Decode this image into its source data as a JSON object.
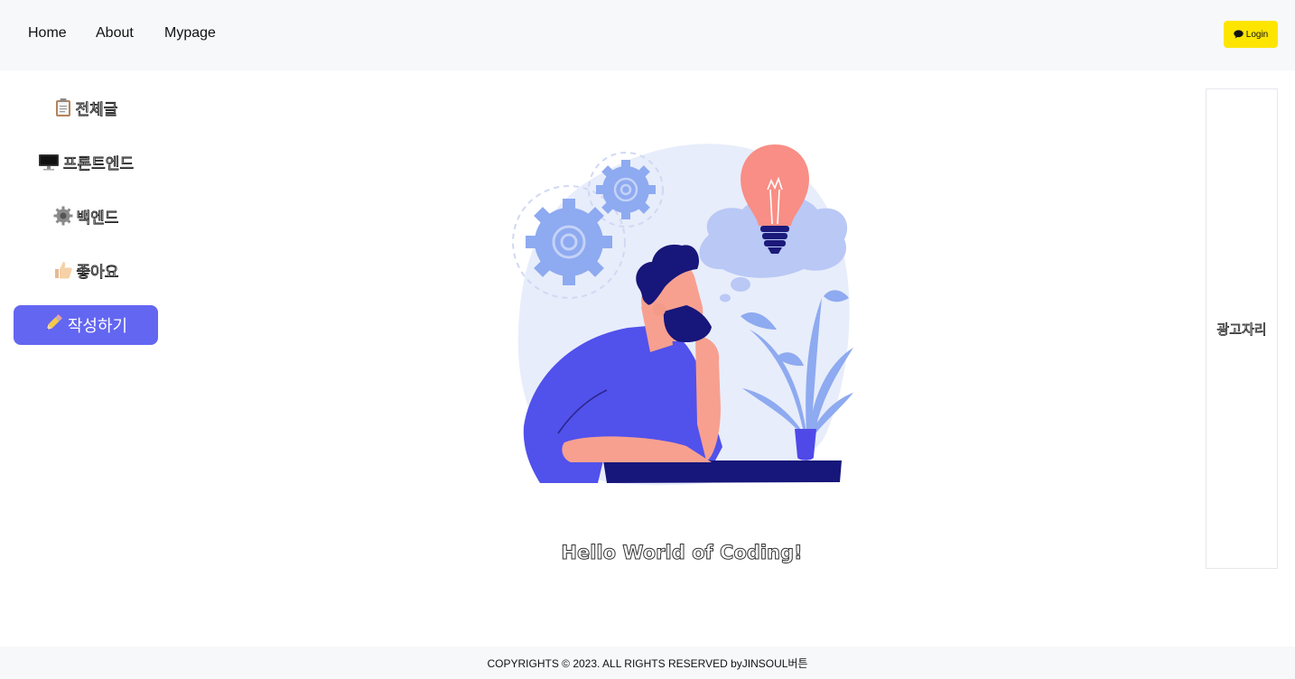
{
  "nav": {
    "items": [
      {
        "label": "Home"
      },
      {
        "label": "About"
      },
      {
        "label": "Mypage"
      }
    ],
    "login_label": "Login"
  },
  "sidebar": {
    "items": [
      {
        "icon": "clipboard-icon",
        "label": "전체글"
      },
      {
        "icon": "desktop-computer-icon",
        "label": "프론트엔드"
      },
      {
        "icon": "gear-icon",
        "label": "백엔드"
      },
      {
        "icon": "thumbs-up-icon",
        "label": "좋아요"
      }
    ],
    "write_button": {
      "icon": "pencil-icon",
      "label": "작성하기"
    }
  },
  "main": {
    "heading": "Hello World of Coding!"
  },
  "ad": {
    "label": "광고자리"
  },
  "footer": {
    "text": "COPYRIGHTS © 2023. ALL RIGHTS RESERVED byJINSOUL버튼"
  },
  "colors": {
    "topbar_bg": "#f7f8fa",
    "login_bg": "#fee500",
    "write_button_bg": "#6366f1",
    "footer_bg": "#f7f8fa"
  }
}
